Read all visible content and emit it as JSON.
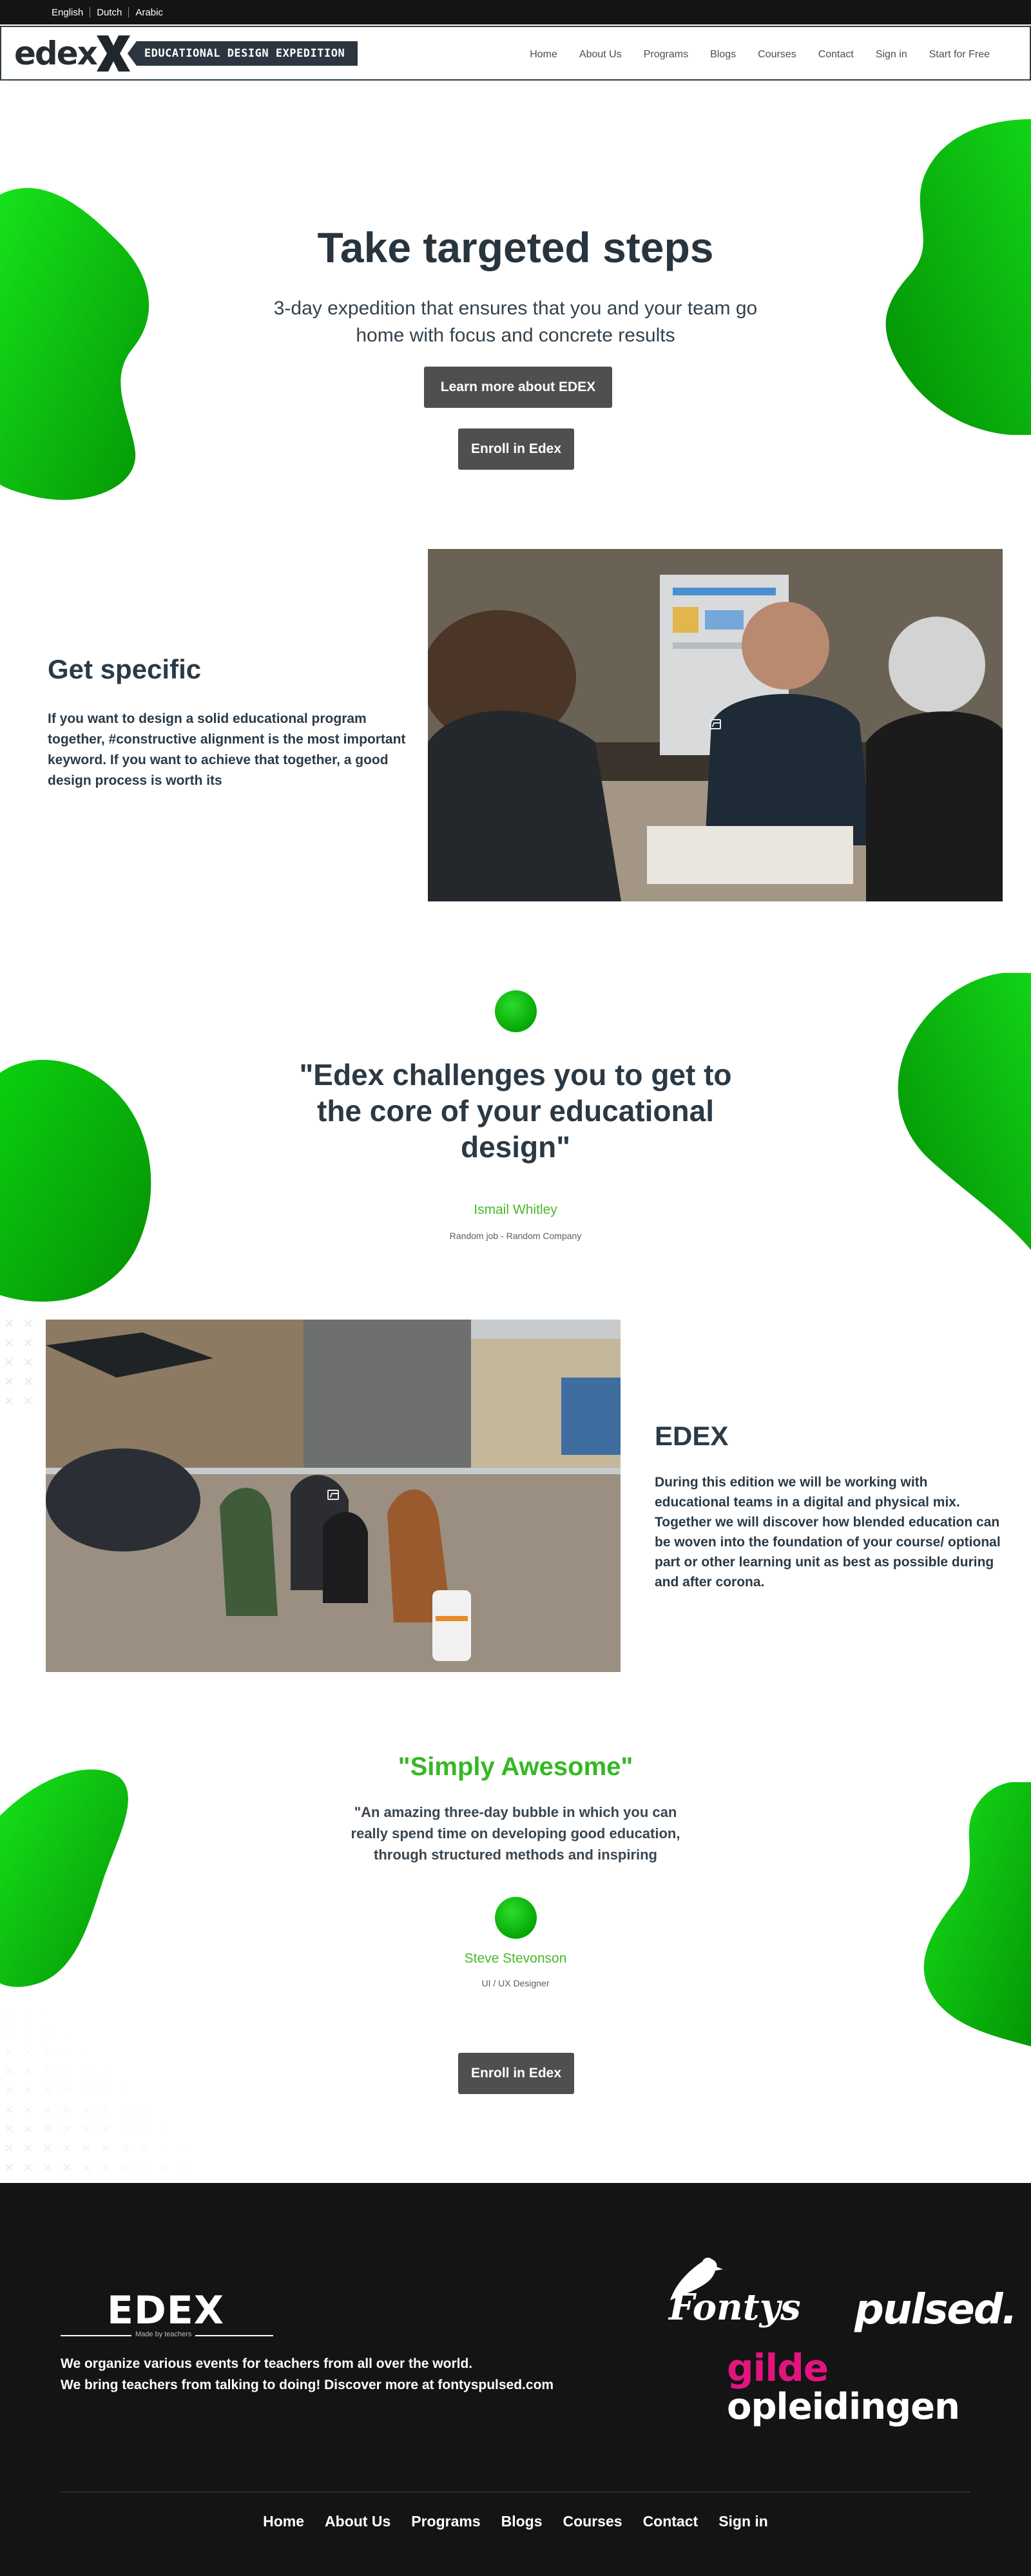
{
  "languages": [
    "English",
    "Dutch",
    "Arabic"
  ],
  "brand": {
    "logo_word": "edex",
    "tagline": "EDUCATIONAL DESIGN EXPEDITION"
  },
  "nav": {
    "items": [
      "Home",
      "About Us",
      "Programs",
      "Blogs",
      "Courses",
      "Contact",
      "Sign in",
      "Start for Free"
    ]
  },
  "hero": {
    "title": "Take targeted steps",
    "subtitle": "3-day expedition that ensures that you and your team go home with focus and concrete results",
    "learn_button": "Learn more about EDEX",
    "enroll_button": "Enroll in Edex"
  },
  "specific": {
    "heading": "Get specific",
    "body": "If you want to design a solid educational program together, #constructive alignment is the most important keyword. If you want to achieve that together, a good design process is worth its"
  },
  "quote": {
    "text": "\"Edex challenges you to get to the core of your educational design\"",
    "name": "Ismail Whitley",
    "role": "Random job - Random Company"
  },
  "edex": {
    "heading": "EDEX",
    "body": "During this edition we will be working with educational teams in a digital and physical mix. Together we will discover how blended education can be woven into the foundation of your course/ optional part or other learning unit as best as possible during and after corona."
  },
  "testimonial": {
    "title": "\"Simply Awesome\"",
    "text": "\"An amazing three-day bubble in which you can really spend time on developing good education, through structured methods and inspiring",
    "name": "Steve Stevonson",
    "role": "UI / UX Designer",
    "enroll_button": "Enroll in Edex"
  },
  "footer": {
    "logo": "EDEX",
    "made_by": "Made by teachers",
    "line1": "We organize various events for teachers from all over the world.",
    "line2": "We bring teachers from talking to doing! Discover more at fontyspulsed.com",
    "partners": {
      "fontys": "Fontys",
      "pulsed": "pulsed.",
      "gilde": "gilde",
      "opleidingen": "opleidingen"
    },
    "nav": [
      "Home",
      "About Us",
      "Programs",
      "Blogs",
      "Courses",
      "Contact",
      "Sign in"
    ]
  },
  "colors": {
    "accent_green": "#36b824",
    "button_gray": "#4f4f4f",
    "dark_text": "#2b3945",
    "footer_bg": "#141414",
    "gilde_pink": "#e4147f"
  }
}
